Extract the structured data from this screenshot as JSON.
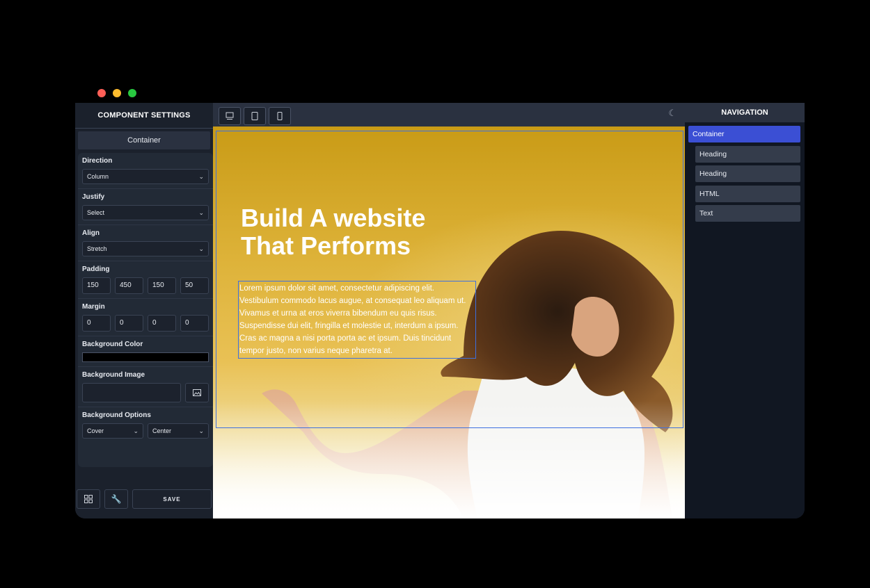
{
  "window": {
    "dots": [
      "#ff5f57",
      "#febc2e",
      "#28c840"
    ]
  },
  "left_panel": {
    "title": "COMPONENT SETTINGS",
    "selected_component": "Container",
    "direction": {
      "label": "Direction",
      "value": "Column"
    },
    "justify": {
      "label": "Justify",
      "value": "Select"
    },
    "align": {
      "label": "Align",
      "value": "Stretch"
    },
    "padding": {
      "label": "Padding",
      "values": [
        "150",
        "450",
        "150",
        "50"
      ]
    },
    "margin": {
      "label": "Margin",
      "values": [
        "0",
        "0",
        "0",
        "0"
      ]
    },
    "bg_color": {
      "label": "Background Color",
      "value": "#000000"
    },
    "bg_image": {
      "label": "Background Image",
      "value": ""
    },
    "bg_options": {
      "label": "Background Options",
      "size": "Cover",
      "position": "Center"
    },
    "footer": {
      "save_label": "SAVE",
      "layout_icon": "grid-icon",
      "tools_icon": "wrench-icon"
    }
  },
  "toolbar": {
    "devices": [
      "desktop-icon",
      "tablet-icon",
      "mobile-icon"
    ],
    "theme_icon": "moon-icon"
  },
  "canvas": {
    "headline": "Build A website That Performs",
    "paragraph": "Lorem ipsum dolor sit amet, consectetur adipiscing elit. Vestibulum commodo lacus augue, at consequat leo aliquam ut. Vivamus et urna at eros viverra bibendum eu quis risus. Suspendisse dui elit, fringilla et molestie ut, interdum a ipsum. Cras ac magna a nisi porta porta ac et ipsum. Duis tincidunt tempor justo, non varius neque pharetra at.",
    "accent": "#3d6fe0"
  },
  "navigation": {
    "title": "NAVIGATION",
    "items": [
      {
        "label": "Container"
      },
      {
        "label": "Heading"
      },
      {
        "label": "Heading"
      },
      {
        "label": "HTML"
      },
      {
        "label": "Text"
      }
    ]
  }
}
